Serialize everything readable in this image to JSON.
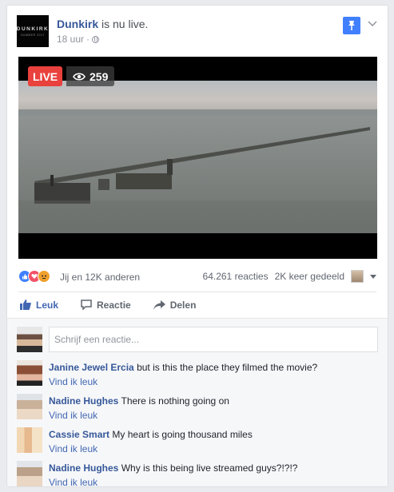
{
  "post": {
    "page_name": "Dunkirk",
    "verb": "is nu live.",
    "time": "18 uur",
    "separator": "·",
    "logo_text": "DUNKIRK",
    "logo_subtext": "SUMMER 2017"
  },
  "video": {
    "live_label": "LIVE",
    "viewer_count": "259"
  },
  "stats": {
    "reactions_text": "Jij en 12K anderen",
    "comments_count": "64.261 reacties",
    "shares_count": "2K keer gedeeld",
    "reaction_icons": [
      "like-icon",
      "love-icon",
      "angry-icon"
    ]
  },
  "actions": {
    "like_label": "Leuk",
    "comment_label": "Reactie",
    "share_label": "Delen"
  },
  "compose": {
    "placeholder": "Schrijf een reactie..."
  },
  "comments": [
    {
      "author": "Janine Jewel Ercia",
      "text": "but is this the place they filmed the movie?",
      "like_link": "Vind ik leuk"
    },
    {
      "author": "Nadine Hughes",
      "text": "There is nothing going on",
      "like_link": "Vind ik leuk"
    },
    {
      "author": "Cassie Smart",
      "text": "My heart is going thousand miles",
      "like_link": "Vind ik leuk"
    },
    {
      "author": "Nadine Hughes",
      "text": "Why is this being live streamed guys?!?!?",
      "like_link": "Vind ik leuk"
    }
  ],
  "colors": {
    "brand_blue": "#4267b2",
    "name_blue": "#365899",
    "live_red": "#e9413d",
    "pin_blue": "#4080ff"
  }
}
